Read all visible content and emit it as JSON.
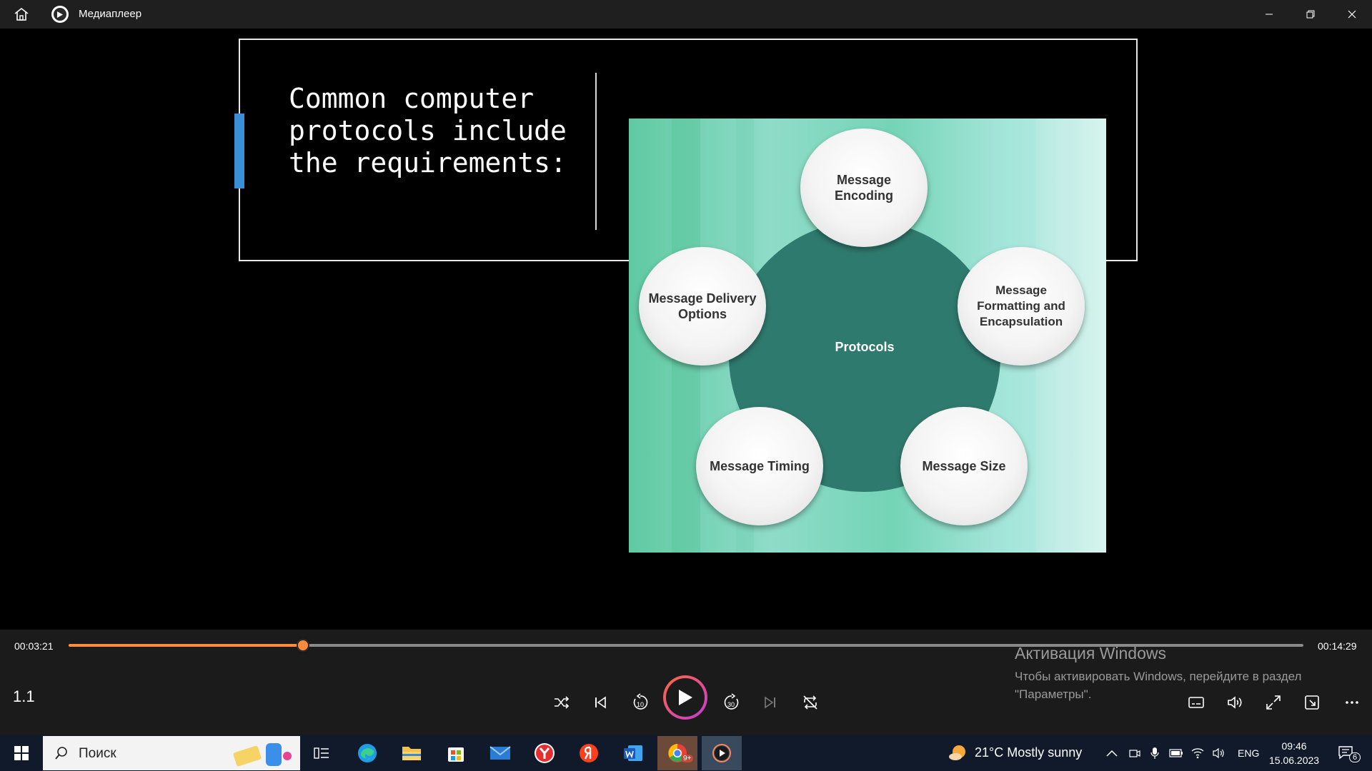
{
  "window": {
    "title": "Медиаплеер"
  },
  "slide": {
    "title": "Common computer protocols include the requirements:",
    "diagram": {
      "center": "Protocols",
      "nodes": {
        "top": "Message Encoding",
        "right": "Message Formatting and Encapsulation",
        "bottom_right": "Message Size",
        "bottom_left": "Message Timing",
        "left": "Message Delivery Options"
      }
    }
  },
  "player": {
    "elapsed": "00:03:21",
    "duration": "00:14:29",
    "progress_fraction": 0.19,
    "chapter": "1.1",
    "skip_back_label": "10",
    "skip_forward_label": "30",
    "accent_color": "#ff8a3d"
  },
  "activation": {
    "title": "Активация Windows",
    "text": "Чтобы активировать Windows, перейдите в раздел \"Параметры\"."
  },
  "taskbar": {
    "search_placeholder": "Поиск",
    "weather": "21°C  Mostly sunny",
    "language": "ENG",
    "time": "09:46",
    "date": "15.06.2023",
    "notification_count": "6",
    "badge": "9+"
  }
}
